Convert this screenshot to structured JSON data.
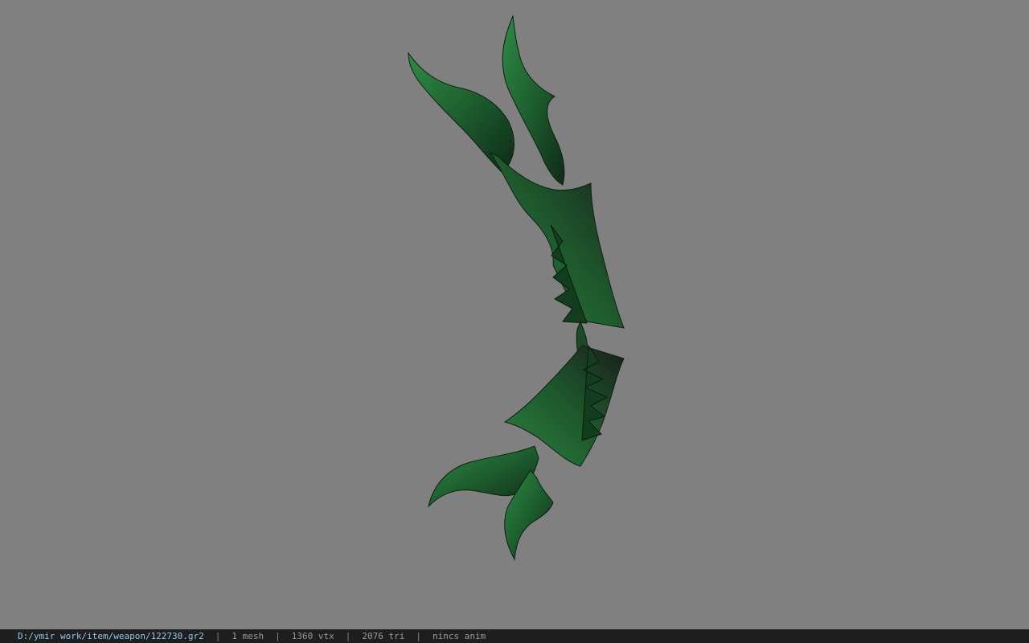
{
  "viewer": {
    "background": "#808080",
    "model": {
      "icon": "green-bow-model",
      "accent": "#1f6b33"
    }
  },
  "statusbar": {
    "file_path": "D:/ymir work/item/weapon/122730.gr2",
    "separator": "|",
    "mesh_count": "1 mesh",
    "vertex_count": "1360 vtx",
    "triangle_count": "2076 tri",
    "anim_status": "nincs anim"
  }
}
